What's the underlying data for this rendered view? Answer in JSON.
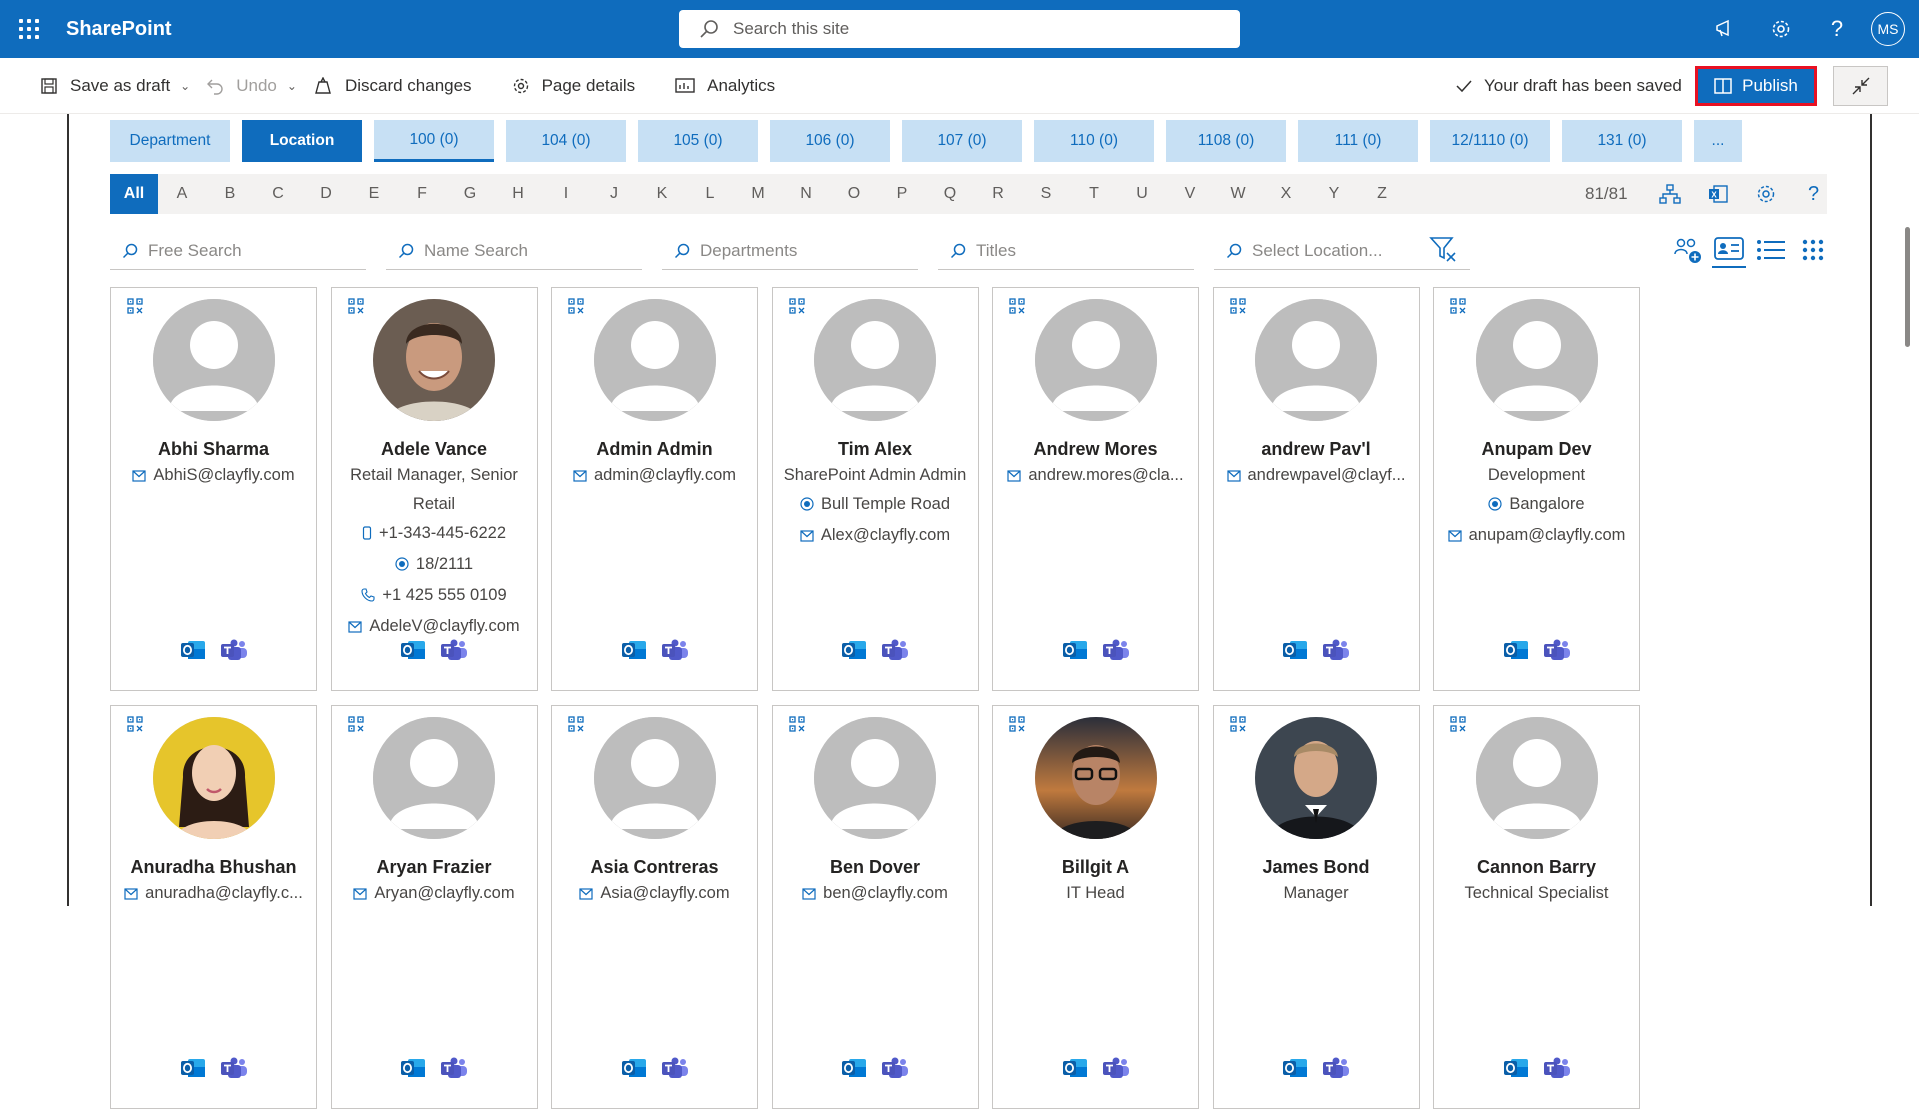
{
  "suite": {
    "brand": "SharePoint",
    "search_placeholder": "Search this site",
    "user_initials": "MS"
  },
  "toolbar": {
    "save_draft": "Save as draft",
    "undo": "Undo",
    "discard": "Discard changes",
    "page_details": "Page details",
    "analytics": "Analytics",
    "saved_status": "Your draft has been saved",
    "publish": "Publish"
  },
  "tabs": [
    {
      "label": "Department"
    },
    {
      "label": "Location"
    },
    {
      "label": "100 (0)"
    },
    {
      "label": "104 (0)"
    },
    {
      "label": "105 (0)"
    },
    {
      "label": "106 (0)"
    },
    {
      "label": "107 (0)"
    },
    {
      "label": "110 (0)"
    },
    {
      "label": "1108 (0)"
    },
    {
      "label": "111 (0)"
    },
    {
      "label": "12/1110 (0)"
    },
    {
      "label": "131 (0)"
    },
    {
      "label": "..."
    }
  ],
  "alphabet": [
    "All",
    "A",
    "B",
    "C",
    "D",
    "E",
    "F",
    "G",
    "H",
    "I",
    "J",
    "K",
    "L",
    "M",
    "N",
    "O",
    "P",
    "Q",
    "R",
    "S",
    "T",
    "U",
    "V",
    "W",
    "X",
    "Y",
    "Z"
  ],
  "result_count": "81/81",
  "filters": [
    {
      "placeholder": "Free Search"
    },
    {
      "placeholder": "Name Search"
    },
    {
      "placeholder": "Departments"
    },
    {
      "placeholder": "Titles"
    },
    {
      "placeholder": "Select Location..."
    }
  ],
  "people": [
    {
      "name": "Abhi Sharma",
      "photo": "none",
      "lines": [
        {
          "icon": "mail",
          "text": "AbhiS@clayfly.com"
        }
      ]
    },
    {
      "name": "Adele Vance",
      "photo": "man-smiling",
      "lines": [
        {
          "icon": "",
          "text": "Retail Manager, Senior Retail",
          "wrap": true
        },
        {
          "icon": "mobile",
          "text": "+1-343-445-6222"
        },
        {
          "icon": "location",
          "text": "18/2111"
        },
        {
          "icon": "phone",
          "text": "+1 425 555 0109"
        },
        {
          "icon": "mail",
          "text": "AdeleV@clayfly.com"
        }
      ]
    },
    {
      "name": "Admin Admin",
      "photo": "none",
      "lines": [
        {
          "icon": "mail",
          "text": "admin@clayfly.com"
        }
      ]
    },
    {
      "name": "Tim Alex",
      "photo": "none",
      "lines": [
        {
          "icon": "",
          "text": "SharePoint Admin Admin",
          "wrap": true
        },
        {
          "icon": "location",
          "text": "Bull Temple Road"
        },
        {
          "icon": "mail",
          "text": "Alex@clayfly.com"
        }
      ]
    },
    {
      "name": "Andrew Mores",
      "photo": "none",
      "lines": [
        {
          "icon": "mail",
          "text": "andrew.mores@cla..."
        }
      ]
    },
    {
      "name": "andrew Pav'l",
      "photo": "none",
      "lines": [
        {
          "icon": "mail",
          "text": "andrewpavel@clayf..."
        }
      ]
    },
    {
      "name": "Anupam Dev",
      "photo": "none",
      "lines": [
        {
          "icon": "",
          "text": "Development"
        },
        {
          "icon": "location",
          "text": "Bangalore"
        },
        {
          "icon": "mail",
          "text": "anupam@clayfly.com"
        }
      ]
    },
    {
      "name": "Anuradha Bhushan",
      "photo": "woman-yellow",
      "lines": [
        {
          "icon": "mail",
          "text": "anuradha@clayfly.c..."
        }
      ]
    },
    {
      "name": "Aryan Frazier",
      "photo": "none",
      "lines": [
        {
          "icon": "mail",
          "text": "Aryan@clayfly.com"
        }
      ]
    },
    {
      "name": "Asia Contreras",
      "photo": "none",
      "lines": [
        {
          "icon": "mail",
          "text": "Asia@clayfly.com"
        }
      ]
    },
    {
      "name": "Ben Dover",
      "photo": "none",
      "lines": [
        {
          "icon": "mail",
          "text": "ben@clayfly.com"
        }
      ]
    },
    {
      "name": "Billgit A",
      "photo": "man-glasses",
      "lines": [
        {
          "icon": "",
          "text": "IT Head"
        }
      ]
    },
    {
      "name": "James Bond",
      "photo": "man-suit",
      "lines": [
        {
          "icon": "",
          "text": "Manager"
        }
      ]
    },
    {
      "name": "Cannon Barry",
      "photo": "none",
      "lines": [
        {
          "icon": "",
          "text": "Technical Specialist"
        }
      ]
    }
  ],
  "colors": {
    "brand_blue": "#0f6cbd",
    "tab_light": "#c7e0f4",
    "publish_outline": "#e81123"
  }
}
